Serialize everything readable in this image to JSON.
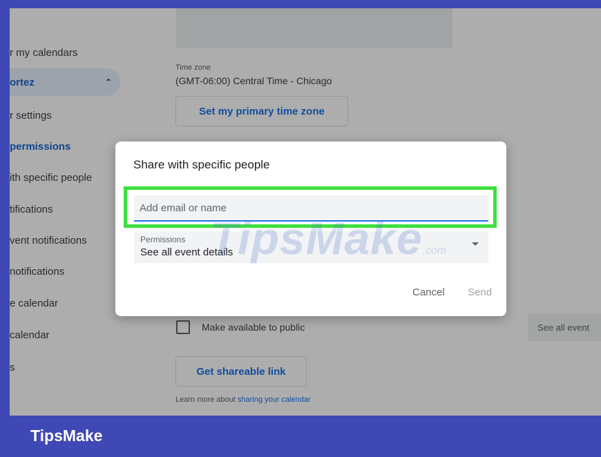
{
  "sidebar": {
    "items": [
      {
        "label": "r my calendars"
      },
      {
        "label": "ortez"
      },
      {
        "label": "r settings"
      },
      {
        "label": "permissions"
      },
      {
        "label": "ith specific people"
      },
      {
        "label": "tifications"
      },
      {
        "label": "vent notifications"
      },
      {
        "label": "notifications"
      },
      {
        "label": "e calendar"
      },
      {
        "label": "calendar"
      },
      {
        "label": "s"
      }
    ]
  },
  "settings": {
    "time_zone_label": "Time zone",
    "time_zone_value": "(GMT-06:00) Central Time - Chicago",
    "primary_tz_button": "Set my primary time zone",
    "public_checkbox_label": "Make available to public",
    "public_access_value": "See all event",
    "shareable_link_button": "Get shareable link",
    "learn_more_text": "Learn more about ",
    "learn_more_link": "sharing your calendar"
  },
  "dialog": {
    "title": "Share with specific people",
    "email_placeholder": "Add email or name",
    "permissions_label": "Permissions",
    "permissions_value": "See all event details",
    "cancel_label": "Cancel",
    "send_label": "Send"
  },
  "watermark": {
    "text": "TipsMake",
    "suffix": ".com"
  },
  "brand": {
    "name": "TipsMake"
  },
  "colors": {
    "frame": "#3f48b4",
    "highlight": "#3ce03c",
    "accent": "#1a73e8"
  }
}
